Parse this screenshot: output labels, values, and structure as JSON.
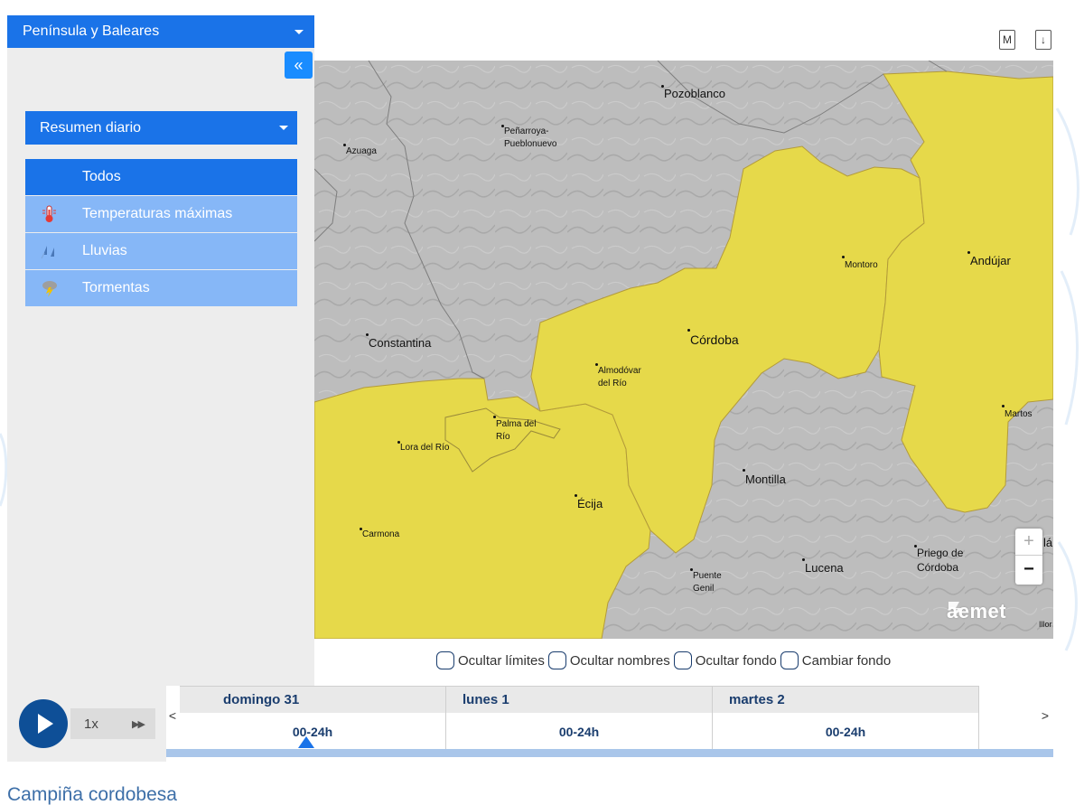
{
  "sidebar": {
    "region_select": "Península y Baleares",
    "collapse_icon": "«",
    "summary_select": "Resumen diario",
    "filters": [
      {
        "label": "Todos",
        "icon": "none",
        "active": true
      },
      {
        "label": "Temperaturas máximas",
        "icon": "thermometer-icon",
        "active": false
      },
      {
        "label": "Lluvias",
        "icon": "rain-icon",
        "active": false
      },
      {
        "label": "Tormentas",
        "icon": "storm-icon",
        "active": false
      }
    ]
  },
  "toolbar": {
    "map_icon_label": "M",
    "download_icon": "↓"
  },
  "map": {
    "cities": {
      "pozoblanco": "Pozoblanco",
      "penarroya": "Peñarroya-\nPueblonuevo",
      "azuaga": "Azuaga",
      "montoro": "Montoro",
      "andujar": "Andújar",
      "constantina": "Constantina",
      "cordoba": "Córdoba",
      "almodovar": "Almodóvar\ndel Río",
      "palma": "Palma del\nRío",
      "lora": "Lora del Río",
      "martos": "Martos",
      "montilla": "Montilla",
      "ecija": "Écija",
      "carmona": "Carmona",
      "priego": "Priego de\nCórdoba",
      "lucena": "Lucena",
      "puente_genil": "Puente\nGenil",
      "edge_a": "lá",
      "edge_b": "Illor"
    },
    "zoom_in": "+",
    "zoom_out": "−",
    "brand": "aemet",
    "colors": {
      "warning_yellow": "#e6d94a",
      "relief_gray": "#bdbdbd",
      "border": "#b39b3a"
    }
  },
  "toggles": [
    "Ocultar límites",
    "Ocultar nombres",
    "Ocultar fondo",
    "Cambiar fondo"
  ],
  "player": {
    "speed": "1x",
    "ff_icon": "▶▶"
  },
  "timeline": {
    "prev_icon": "<",
    "next_icon": ">",
    "days": [
      {
        "name": "domingo 31",
        "slot": "00-24h"
      },
      {
        "name": "lunes 1",
        "slot": "00-24h"
      },
      {
        "name": "martes 2",
        "slot": "00-24h"
      }
    ]
  },
  "zone_title": "Campiña cordobesa"
}
